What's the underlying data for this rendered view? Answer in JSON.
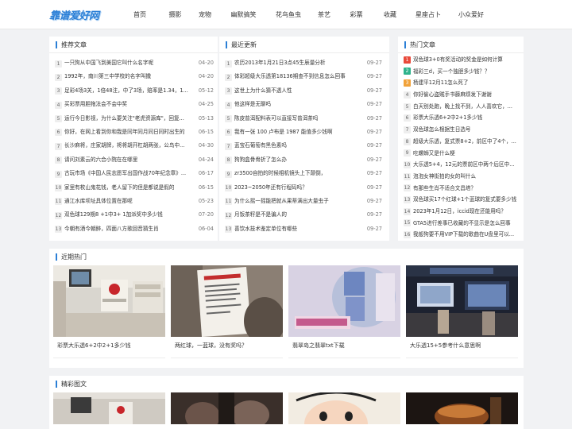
{
  "site": {
    "logo": "靠谱爱好网"
  },
  "nav": [
    "首页",
    "摄影",
    "宠物",
    "幽默搞笑",
    "花鸟鱼虫",
    "茶艺",
    "彩票",
    "收藏",
    "星座占卜",
    "小众爱好"
  ],
  "recommend": {
    "title": "推荐文章",
    "items": [
      {
        "n": "1",
        "t": "一只狗从中国飞到美国它叫什么名字呢",
        "d": "04-20"
      },
      {
        "n": "2",
        "t": "1992年，南川第三中学校的名字叫撒",
        "d": "04-20"
      },
      {
        "n": "3",
        "t": "足彩4场3关，1倍48注，中了3场，赔率是1.34，1...",
        "d": "05-12"
      },
      {
        "n": "4",
        "t": "买彩票用胆拖法会不会中奖",
        "d": "04-25"
      },
      {
        "n": "5",
        "t": "运行今日影视，为什么要关注\"老虎资源库\"，回复...",
        "d": "05-13"
      },
      {
        "n": "6",
        "t": "你好，在网上看到你和我是同年同月同日同时出生的",
        "d": "06-15"
      },
      {
        "n": "7",
        "t": "长沙麻将，庄家胡牌，将将胡开杠胡两张，公鸟中...",
        "d": "04-30"
      },
      {
        "n": "8",
        "t": "请问刘素云的六合小院在在哪里",
        "d": "04-24"
      },
      {
        "n": "9",
        "t": "古玩市场《中国人民志愿军出国作战70年纪念章》...",
        "d": "06-17"
      },
      {
        "n": "10",
        "t": "家里有枚山鬼花钱，老人留下的但是都说是假的",
        "d": "06-15"
      },
      {
        "n": "11",
        "t": "通江水库坝址具体位置在那呢",
        "d": "05-23"
      },
      {
        "n": "12",
        "t": "双色球129期8 +1中3+ 1加派奖中多少钱",
        "d": "07-20"
      },
      {
        "n": "13",
        "t": "今朝有酒今朝醉，四面八方歌回音猜生肖",
        "d": "06-04"
      }
    ]
  },
  "latest": {
    "title": "最近更新",
    "items": [
      {
        "n": "1",
        "t": "农历2013年1月21日3点45生辰量分析",
        "d": "09-27"
      },
      {
        "n": "2",
        "t": "体彩超级大乐透第18136期查不到信息怎么回事",
        "d": "09-27"
      },
      {
        "n": "3",
        "t": "这世上为什么猜不透人性",
        "d": "09-27"
      },
      {
        "n": "4",
        "t": "他这样是无聊吗",
        "d": "09-27"
      },
      {
        "n": "5",
        "t": "陈皮普洱配料表可以直接写普洱茶吗",
        "d": "09-27"
      },
      {
        "n": "6",
        "t": "我有一张 100 卢布是 1987 能值多少钱啊",
        "d": "09-27"
      },
      {
        "n": "7",
        "t": "蓝宝石葡萄有黑色素吗",
        "d": "09-27"
      },
      {
        "n": "8",
        "t": "狗狗盒骨骨折了怎么办",
        "d": "09-27"
      },
      {
        "n": "9",
        "t": "zr3500自拍的时候相机镜头上下颠倒，",
        "d": "09-27"
      },
      {
        "n": "10",
        "t": "2023~2050年还有行程码吗？",
        "d": "09-27"
      },
      {
        "n": "11",
        "t": "为什么摇一摇能把就从果蒂满出大量虫子",
        "d": "09-27"
      },
      {
        "n": "12",
        "t": "月饭茶籽是不是骗人的",
        "d": "09-27"
      },
      {
        "n": "13",
        "t": "喜饮水技术鉴定单位有哪些",
        "d": "09-27"
      }
    ]
  },
  "hot": {
    "title": "热门文章",
    "items": [
      {
        "n": "1",
        "t": "双色球3+0有奖活动的奖金是如何计算"
      },
      {
        "n": "2",
        "t": "福彩三d，买一个独胆多少钱？？"
      },
      {
        "n": "3",
        "t": "杨建平12月11怎么死了"
      },
      {
        "n": "4",
        "t": "你好偷心盗贼手书藤麻烦发下谢谢"
      },
      {
        "n": "5",
        "t": "白天别处跑，晚上找不到，人人喜欢它，..."
      },
      {
        "n": "6",
        "t": "彩票大乐透6+2中2+1多少钱"
      },
      {
        "n": "7",
        "t": "双色球怎么根据生日选号"
      },
      {
        "n": "8",
        "t": "超级大乐透，复式票8+2，前区中了4个，..."
      },
      {
        "n": "9",
        "t": "吃螺蛳又是什么梗"
      },
      {
        "n": "10",
        "t": "大乐透5+4，12元的票前区中两个后区中..."
      },
      {
        "n": "11",
        "t": "泡泡女神街拍的女的叫什么"
      },
      {
        "n": "12",
        "t": "有那些生肖不适合文昌塔？"
      },
      {
        "n": "13",
        "t": "双色球买17个红球+1个蓝球的复式要多少钱"
      },
      {
        "n": "14",
        "t": "2023年1月12日，iccid现在还能用吗？"
      },
      {
        "n": "15",
        "t": "GTA5进行差事已收藏的不显示是怎么回事"
      },
      {
        "n": "16",
        "t": "我般狗要不用VIP下载的歌曲在U盘里可以..."
      }
    ]
  },
  "recent_hot": {
    "title": "近期热门",
    "cards": [
      {
        "caption": "彩票大乐透6+2中2+1多少钱"
      },
      {
        "caption": "两红球，一蓝球，没有奖吗？"
      },
      {
        "caption": "翡翠岛之翡翠txt下载"
      },
      {
        "caption": "大乐透15+5参考什么意思啊"
      }
    ]
  },
  "gallery": {
    "title": "精彩图文"
  },
  "colors": {
    "accent": "#2b7fd6",
    "hot1": "#e94a3b",
    "hot2": "#2fb38c",
    "hot3": "#f1a23a"
  }
}
